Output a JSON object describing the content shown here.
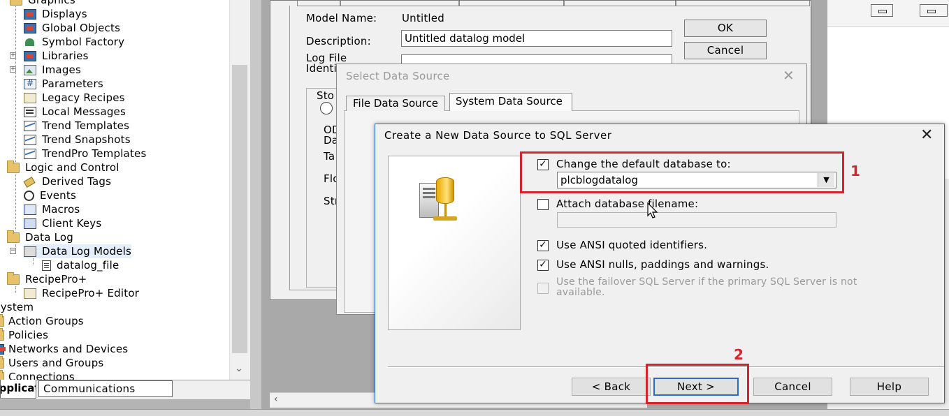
{
  "explorer": {
    "items": [
      {
        "label": "Graphics",
        "icon": "folder-icon"
      },
      {
        "label": "Displays",
        "icon": "display-icon"
      },
      {
        "label": "Global Objects",
        "icon": "display-icon"
      },
      {
        "label": "Symbol Factory",
        "icon": "symbol-factory-icon"
      },
      {
        "label": "Libraries",
        "icon": "display-icon"
      },
      {
        "label": "Images",
        "icon": "image-icon"
      },
      {
        "label": "Parameters",
        "icon": "parameters-icon"
      },
      {
        "label": "Legacy Recipes",
        "icon": "recipe-icon"
      },
      {
        "label": "Local Messages",
        "icon": "message-icon"
      },
      {
        "label": "Trend Templates",
        "icon": "trend-icon"
      },
      {
        "label": "Trend Snapshots",
        "icon": "trend-icon"
      },
      {
        "label": "TrendPro Templates",
        "icon": "trend-icon"
      },
      {
        "label": "Logic and Control",
        "icon": "folder-icon"
      },
      {
        "label": "Derived Tags",
        "icon": "tag-icon"
      },
      {
        "label": "Events",
        "icon": "event-icon"
      },
      {
        "label": "Macros",
        "icon": "macro-icon"
      },
      {
        "label": "Client Keys",
        "icon": "keys-icon"
      },
      {
        "label": "Data Log",
        "icon": "folder-icon"
      },
      {
        "label": "Data Log Models",
        "icon": "models-icon"
      },
      {
        "label": "datalog_file",
        "icon": "file-icon"
      },
      {
        "label": "RecipePro+",
        "icon": "folder-icon"
      },
      {
        "label": "RecipePro+ Editor",
        "icon": "editor-icon"
      },
      {
        "label": "System",
        "icon": ""
      },
      {
        "label": "Action Groups",
        "icon": "folder-icon"
      },
      {
        "label": "Policies",
        "icon": "folder-icon"
      },
      {
        "label": "Networks and Devices",
        "icon": "network-icon"
      },
      {
        "label": "Users and Groups",
        "icon": "folder-icon"
      },
      {
        "label": "Connections",
        "icon": "folder-icon"
      }
    ],
    "tabs": {
      "application": "Application",
      "communications": "Communications"
    }
  },
  "model_window": {
    "model_name_label": "Model Name:",
    "model_name_value": "Untitled",
    "description_label": "Description:",
    "description_value": "Untitled datalog model",
    "log_file_label_1": "Log File",
    "log_file_label_2": "Identi",
    "ok_label": "OK",
    "cancel_label": "Cancel",
    "storage_label": "Sto",
    "od_label_1": "OD",
    "od_label_2": "Da",
    "ta_label": "Ta",
    "flo_label": "Flo",
    "str_label": "Str"
  },
  "select_data_source": {
    "title": "Select Data Source",
    "tab_file": "File Data Source",
    "tab_system": "System Data Source"
  },
  "create_dialog": {
    "title": "Create a New Data Source to SQL Server",
    "change_default_db_label": "Change the default database to:",
    "change_default_db_checked": true,
    "database_value": "plcblogdatalog",
    "attach_db_label": "Attach database filename:",
    "attach_db_checked": false,
    "ansi_quoted_label": "Use ANSI quoted identifiers.",
    "ansi_quoted_checked": true,
    "ansi_nulls_label": "Use ANSI nulls, paddings and warnings.",
    "ansi_nulls_checked": true,
    "failover_label_1": "Use the failover SQL Server if the primary SQL Server is not",
    "failover_label_2": "available.",
    "failover_checked": false,
    "buttons": {
      "back": "< Back",
      "next": "Next >",
      "cancel": "Cancel",
      "help": "Help"
    }
  },
  "annotations": {
    "marker_1": "1",
    "marker_2": "2",
    "color": "#d4242c"
  }
}
